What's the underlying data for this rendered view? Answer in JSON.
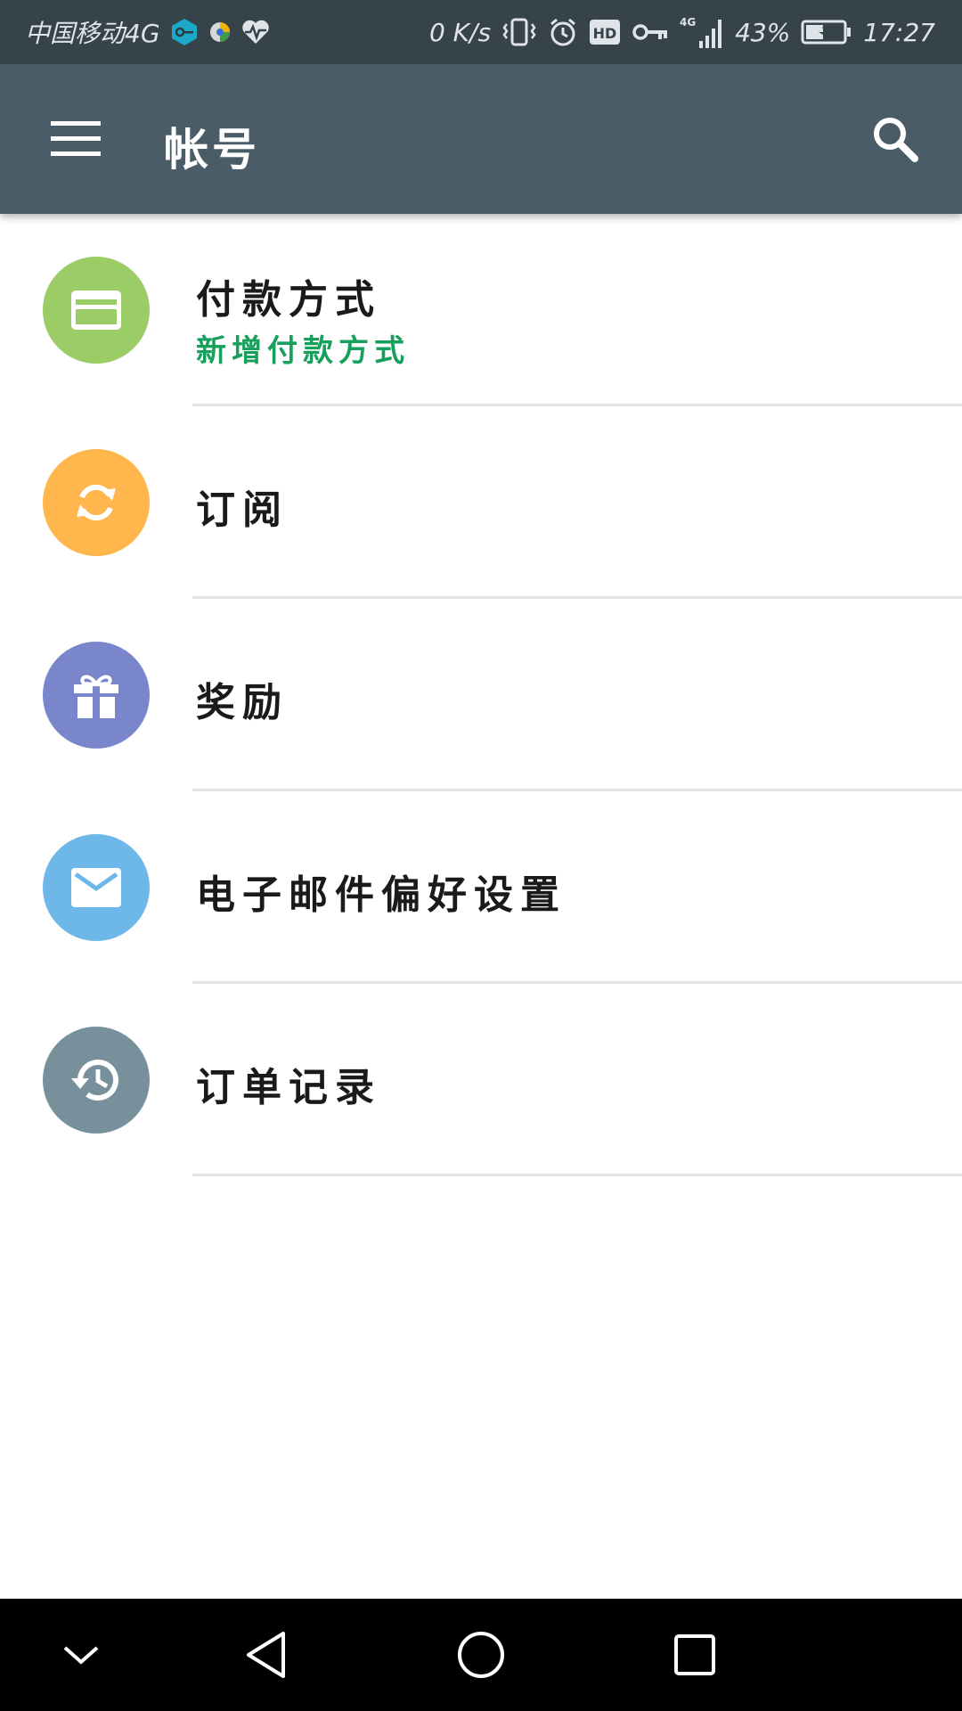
{
  "status_bar": {
    "carrier": "中国移动4G",
    "net_speed": "0  K/s",
    "network_type": "4G",
    "battery": "43%",
    "time": "17:27",
    "icons": [
      "vpn-key-app-icon",
      "browser-app-icon",
      "heart-rate-icon",
      "vibrate-icon",
      "alarm-icon",
      "hd-icon",
      "key-icon",
      "signal-icon",
      "battery-charging-icon"
    ]
  },
  "app_bar": {
    "title": "帐号",
    "menu_icon": "hamburger-menu-icon",
    "search_icon": "search-icon",
    "background": "#4a5c67"
  },
  "list": {
    "items": [
      {
        "label": "付款方式",
        "sublabel": "新增付款方式",
        "icon": "credit-card-icon",
        "color": "#9ccc65"
      },
      {
        "label": "订阅",
        "icon": "refresh-icon",
        "color": "#ffb74d"
      },
      {
        "label": "奖励",
        "icon": "gift-icon",
        "color": "#7986cb"
      },
      {
        "label": "电子邮件偏好设置",
        "icon": "mail-icon",
        "color": "#6db8e8"
      },
      {
        "label": "订单记录",
        "icon": "history-icon",
        "color": "#78909c"
      }
    ],
    "sublabel_color": "#16a05c"
  },
  "nav_bar": {
    "icons": [
      "collapse-icon",
      "back-icon",
      "home-icon",
      "recents-icon"
    ]
  }
}
